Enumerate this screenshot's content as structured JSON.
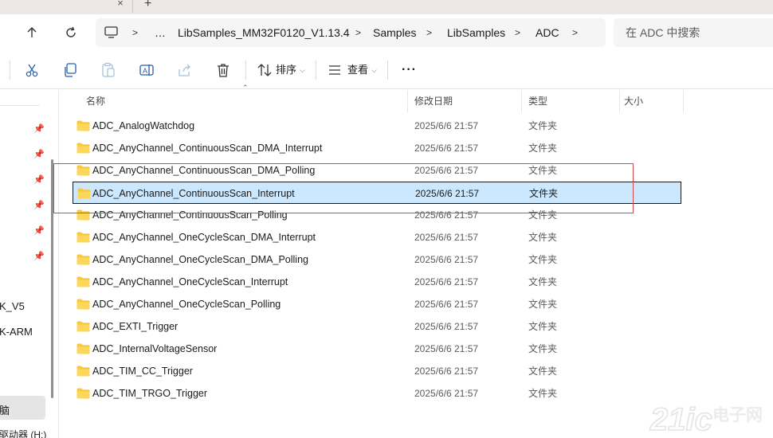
{
  "window": {
    "tab_close_glyph": "×",
    "tab_new_glyph": "+"
  },
  "address": {
    "back_icon": "arrow-up-icon",
    "refresh_icon": "refresh-icon",
    "breadcrumb": [
      {
        "label": "…"
      },
      {
        "label": "LibSamples_MM32F0120_V1.13.4"
      },
      {
        "label": "Samples"
      },
      {
        "label": "LibSamples"
      },
      {
        "label": "ADC"
      }
    ],
    "search_placeholder": "在 ADC 中搜索"
  },
  "toolbar": {
    "sort_label": "排序",
    "view_label": "查看",
    "more_glyph": "···",
    "icons": [
      "cut-icon",
      "copy-icon",
      "paste-icon",
      "rename-icon",
      "share-icon",
      "delete-icon"
    ]
  },
  "navpane": {
    "items": [
      {
        "label": "K_V5"
      },
      {
        "label": "K-ARM"
      },
      {
        "label": "脑"
      },
      {
        "label": "驱动器 (H:)"
      }
    ]
  },
  "columns": {
    "name": "名称",
    "modified": "修改日期",
    "type": "类型",
    "size": "大小"
  },
  "files": [
    {
      "name": "ADC_AnalogWatchdog",
      "date": "2025/6/6 21:57",
      "type": "文件夹"
    },
    {
      "name": "ADC_AnyChannel_ContinuousScan_DMA_Interrupt",
      "date": "2025/6/6 21:57",
      "type": "文件夹"
    },
    {
      "name": "ADC_AnyChannel_ContinuousScan_DMA_Polling",
      "date": "2025/6/6 21:57",
      "type": "文件夹"
    },
    {
      "name": "ADC_AnyChannel_ContinuousScan_Interrupt",
      "date": "2025/6/6 21:57",
      "type": "文件夹",
      "selected": true
    },
    {
      "name": "ADC_AnyChannel_ContinuousScan_Polling",
      "date": "2025/6/6 21:57",
      "type": "文件夹"
    },
    {
      "name": "ADC_AnyChannel_OneCycleScan_DMA_Interrupt",
      "date": "2025/6/6 21:57",
      "type": "文件夹"
    },
    {
      "name": "ADC_AnyChannel_OneCycleScan_DMA_Polling",
      "date": "2025/6/6 21:57",
      "type": "文件夹"
    },
    {
      "name": "ADC_AnyChannel_OneCycleScan_Interrupt",
      "date": "2025/6/6 21:57",
      "type": "文件夹"
    },
    {
      "name": "ADC_AnyChannel_OneCycleScan_Polling",
      "date": "2025/6/6 21:57",
      "type": "文件夹"
    },
    {
      "name": "ADC_EXTI_Trigger",
      "date": "2025/6/6 21:57",
      "type": "文件夹"
    },
    {
      "name": "ADC_InternalVoltageSensor",
      "date": "2025/6/6 21:57",
      "type": "文件夹"
    },
    {
      "name": "ADC_TIM_CC_Trigger",
      "date": "2025/6/6 21:57",
      "type": "文件夹"
    },
    {
      "name": "ADC_TIM_TRGO_Trigger",
      "date": "2025/6/6 21:57",
      "type": "文件夹"
    }
  ],
  "watermark": {
    "brand": "21ic",
    "text": "电子网"
  },
  "colors": {
    "selection_bg": "#cce8ff",
    "folder_yellow": "#f8c93c",
    "annotation_red": "#d8494d"
  }
}
